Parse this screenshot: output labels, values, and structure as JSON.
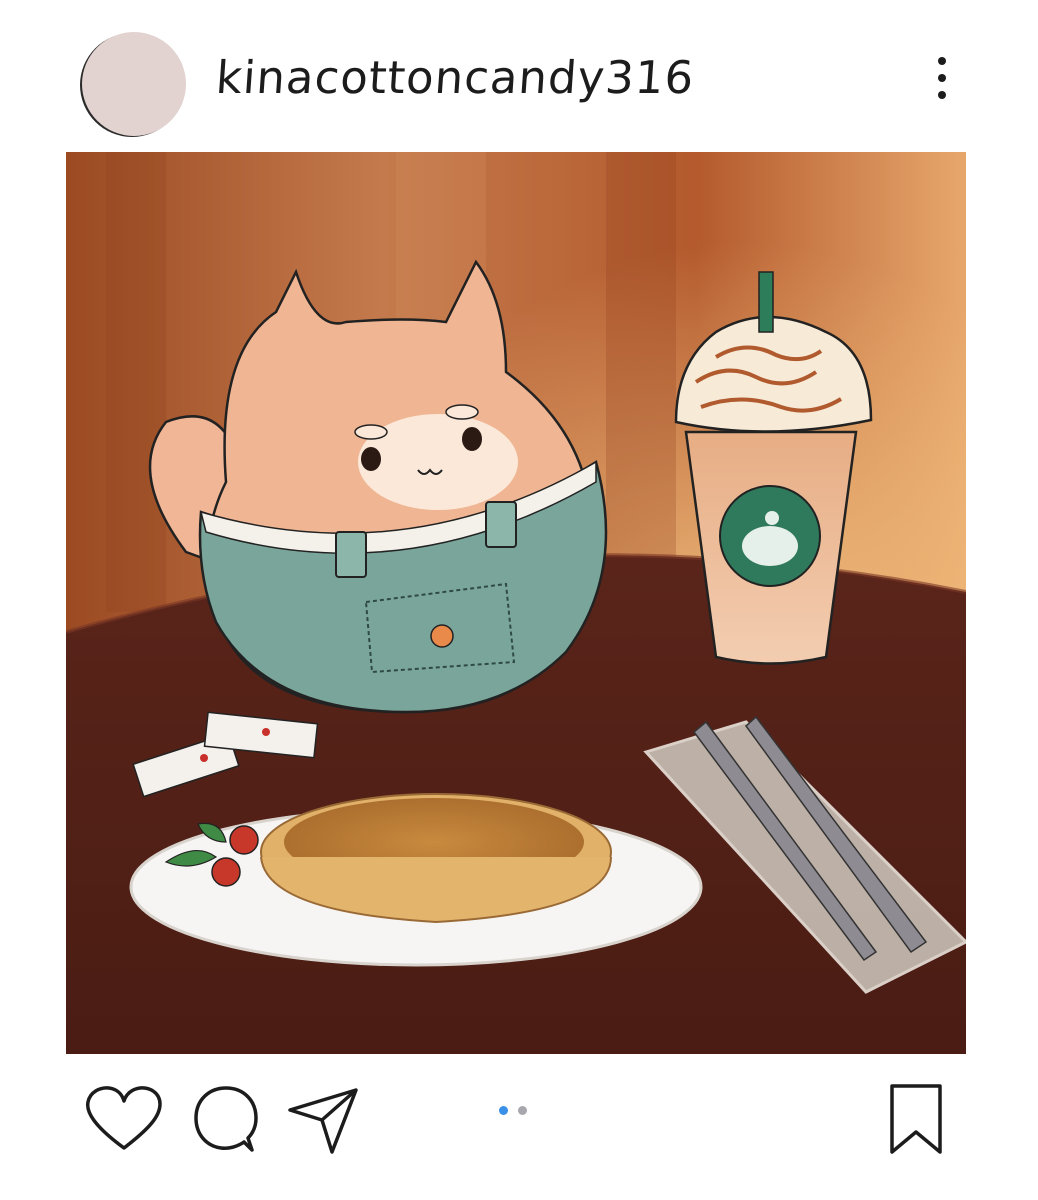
{
  "post": {
    "username": "kinacottoncandy316",
    "avatar_color": "#e2d3d0"
  },
  "icons": {
    "more": "more-vertical-icon",
    "like": "heart-icon",
    "comment": "comment-bubble-icon",
    "share": "paper-plane-icon",
    "save": "bookmark-icon"
  },
  "carousel": {
    "total": 2,
    "current": 1,
    "active_color": "#3a8fe8",
    "inactive_color": "#a7a7ad"
  }
}
